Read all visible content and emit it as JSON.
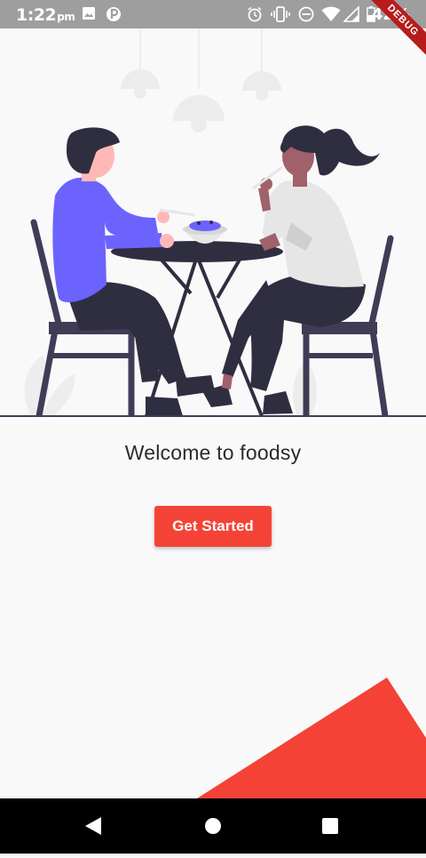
{
  "status_bar": {
    "time": "1:22",
    "time_suffix": "pm",
    "battery": "42%",
    "debug_banner": "DEBUG"
  },
  "main": {
    "welcome_text": "Welcome to foodsy",
    "get_started_label": "Get Started"
  },
  "colors": {
    "accent": "#f44336",
    "figure_shirt": "#6c63ff",
    "dark": "#2f2e41"
  },
  "icons": {
    "status_left": [
      "image-icon",
      "parking-icon"
    ],
    "status_right": [
      "alarm-icon",
      "vibrate-icon",
      "do-not-disturb-icon",
      "wifi-icon",
      "signal-icon",
      "battery-icon"
    ],
    "navigation": [
      "back-icon",
      "home-icon",
      "recents-icon"
    ]
  }
}
